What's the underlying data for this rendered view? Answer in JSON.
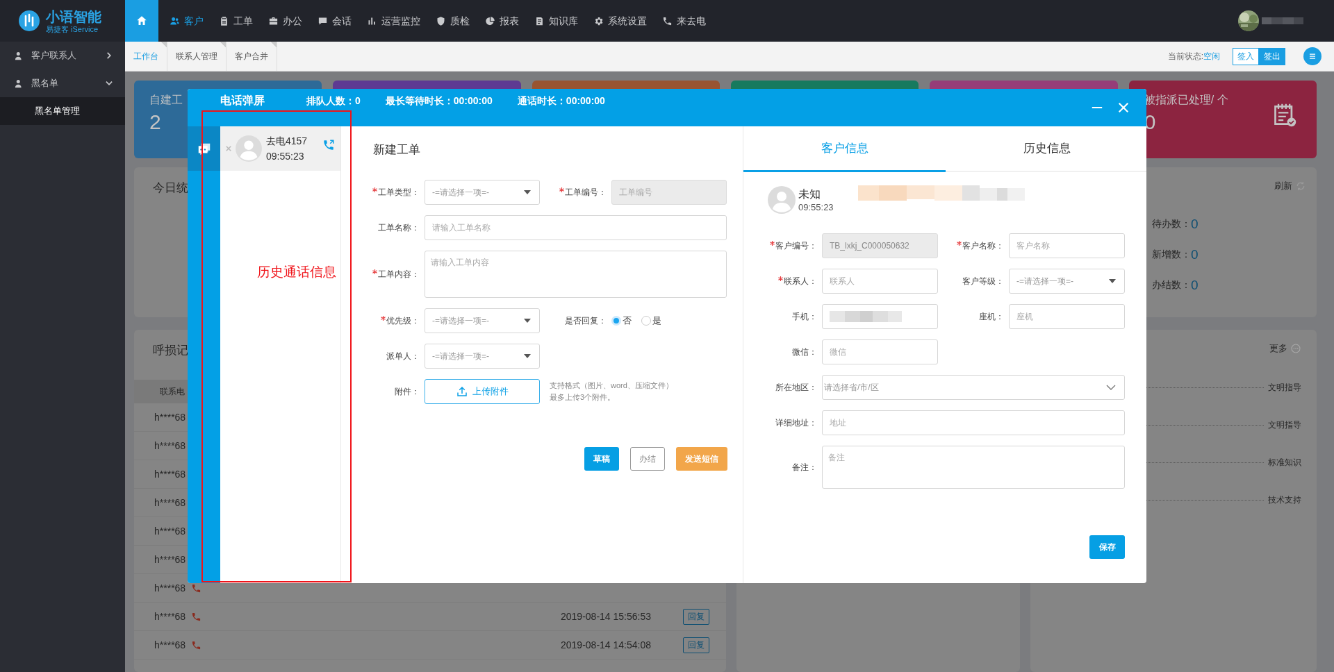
{
  "topbar": {
    "logo_title": "小语智能",
    "logo_subtitle": "易捷客 iService",
    "home_selected": true,
    "nav": [
      {
        "label": "客户",
        "selected": true
      },
      {
        "label": "工单",
        "selected": false
      },
      {
        "label": "办公",
        "selected": false
      },
      {
        "label": "会话",
        "selected": false
      },
      {
        "label": "运营监控",
        "selected": false
      },
      {
        "label": "质检",
        "selected": false
      },
      {
        "label": "报表",
        "selected": false
      },
      {
        "label": "知识库",
        "selected": false
      },
      {
        "label": "系统设置",
        "selected": false
      },
      {
        "label": "来去电",
        "selected": false
      }
    ]
  },
  "sidebar": {
    "items": [
      {
        "label": "客户联系人",
        "expanded": false
      },
      {
        "label": "黑名单",
        "expanded": true,
        "children": [
          {
            "label": "黑名单管理",
            "selected": true
          }
        ]
      }
    ]
  },
  "tabs": [
    {
      "label": "工作台",
      "selected": true
    },
    {
      "label": "联系人管理",
      "selected": false
    },
    {
      "label": "客户合并",
      "selected": false
    }
  ],
  "status": {
    "label": "当前状态:",
    "value": "空闲"
  },
  "sign_buttons": [
    {
      "label": "签入",
      "selected": false
    },
    {
      "label": "签出",
      "selected": true
    }
  ],
  "stat_cards": [
    {
      "label": "自建工",
      "value": "2",
      "color": "#2d6a98"
    },
    {
      "color": "#5e3a92"
    },
    {
      "color": "#985431"
    },
    {
      "color": "#177a5e"
    },
    {
      "color": "#963d78"
    },
    {
      "label": "被指派已处理/ 个",
      "value": "0",
      "color": "#8c2440"
    }
  ],
  "today_stats": {
    "title": "今日统",
    "refresh": "刷新",
    "metrics": [
      {
        "label": "待办数：",
        "value": "0"
      },
      {
        "label": "新增数：",
        "value": "0"
      },
      {
        "label": "办结数：",
        "value": "0"
      }
    ]
  },
  "missed_calls": {
    "title": "呼损记",
    "column_1": "联系电",
    "rows": [
      {
        "contact": "h****68"
      },
      {
        "contact": "h****68"
      },
      {
        "contact": "h****68"
      },
      {
        "contact": "h****68"
      },
      {
        "contact": "h****68"
      },
      {
        "contact": "h****68"
      },
      {
        "contact": "h****68",
        "call_icon": true
      },
      {
        "contact": "h****68",
        "call_icon": true,
        "date": "2019-08-14 15:56:53",
        "action": "回复"
      },
      {
        "contact": "h****68",
        "call_icon": true,
        "date": "2019-08-14 14:54:08",
        "action": "回复"
      }
    ]
  },
  "knowledge": {
    "more": "更多",
    "categories": [
      "文明指导",
      "文明指导",
      "标准知识",
      "技术支持"
    ]
  },
  "dialog": {
    "title": "电话弹屏",
    "stats": [
      {
        "label": "排队人数：",
        "value": "0"
      },
      {
        "label": "最长等待时长：",
        "value": "00:00:00"
      },
      {
        "label": "通话时长：",
        "value": "00:00:00"
      }
    ],
    "calls": [
      {
        "title": "去电4157",
        "time": "09:55:23",
        "selected": true
      }
    ],
    "work_order": {
      "title": "新建工单",
      "rows": [
        [
          {
            "label": "工单类型：",
            "required": true,
            "kind": "select",
            "placeholder": "-=请选择一项=-"
          },
          {
            "label": "工单编号：",
            "required": true,
            "kind": "text",
            "disabled": true,
            "placeholder": "工单编号"
          }
        ],
        [
          {
            "label": "工单名称：",
            "required": false,
            "kind": "long_text",
            "placeholder": "请输入工单名称"
          }
        ],
        [
          {
            "label": "工单内容：",
            "required": true,
            "kind": "textarea",
            "placeholder": "请输入工单内容"
          }
        ],
        [
          {
            "label": "优先级：",
            "required": true,
            "kind": "select",
            "placeholder": "-=请选择一项=-"
          },
          {
            "label": "是否回复：",
            "required": false,
            "kind": "radio",
            "options": [
              {
                "label": "否",
                "selected": true
              },
              {
                "label": "是",
                "selected": false
              }
            ]
          }
        ],
        [
          {
            "label": "派单人：",
            "required": false,
            "kind": "select",
            "placeholder": "-=请选择一项=-"
          }
        ],
        [
          {
            "label": "附件：",
            "required": false,
            "kind": "upload",
            "button": "上传附件",
            "hint": [
              "支持格式（图片、word、压缩文件）",
              "最多上传3个附件。"
            ]
          }
        ]
      ],
      "buttons": [
        {
          "label": "草稿",
          "kind": "primary"
        },
        {
          "label": "办结",
          "kind": "plain"
        },
        {
          "label": "发送短信",
          "kind": "warning"
        }
      ]
    },
    "customer": {
      "tabs": [
        {
          "label": "客户信息",
          "selected": true
        },
        {
          "label": "历史信息",
          "selected": false
        }
      ],
      "name": "未知",
      "time": "09:55:23",
      "number_redacted": true,
      "rows": [
        [
          {
            "label": "客户编号：",
            "required": true,
            "kind": "text",
            "disabled": true,
            "value": "TB_lxkj_C000050632"
          },
          {
            "label": "客户名称：",
            "required": true,
            "kind": "text",
            "disabled": false,
            "placeholder": "客户名称"
          }
        ],
        [
          {
            "label": "联系人：",
            "required": true,
            "kind": "text",
            "disabled": false,
            "placeholder": "联系人"
          },
          {
            "label": "客户等级：",
            "required": false,
            "kind": "select",
            "placeholder": "-=请选择一项=-"
          }
        ],
        [
          {
            "label": "手机：",
            "required": false,
            "kind": "redacted"
          },
          {
            "label": "座机：",
            "required": false,
            "kind": "text",
            "disabled": false,
            "placeholder": "座机"
          }
        ],
        [
          {
            "label": "微信：",
            "required": false,
            "kind": "text",
            "disabled": false,
            "placeholder": "微信"
          }
        ],
        [
          {
            "label": "所在地区：",
            "required": false,
            "kind": "region",
            "placeholder": "请选择省/市/区"
          }
        ],
        [
          {
            "label": "详细地址：",
            "required": false,
            "kind": "long_text",
            "placeholder": "地址"
          }
        ],
        [
          {
            "label": "备注：",
            "required": false,
            "kind": "textarea",
            "placeholder": "备注"
          }
        ]
      ],
      "save": "保存"
    }
  },
  "annotation": {
    "label": "历史通话信息"
  }
}
